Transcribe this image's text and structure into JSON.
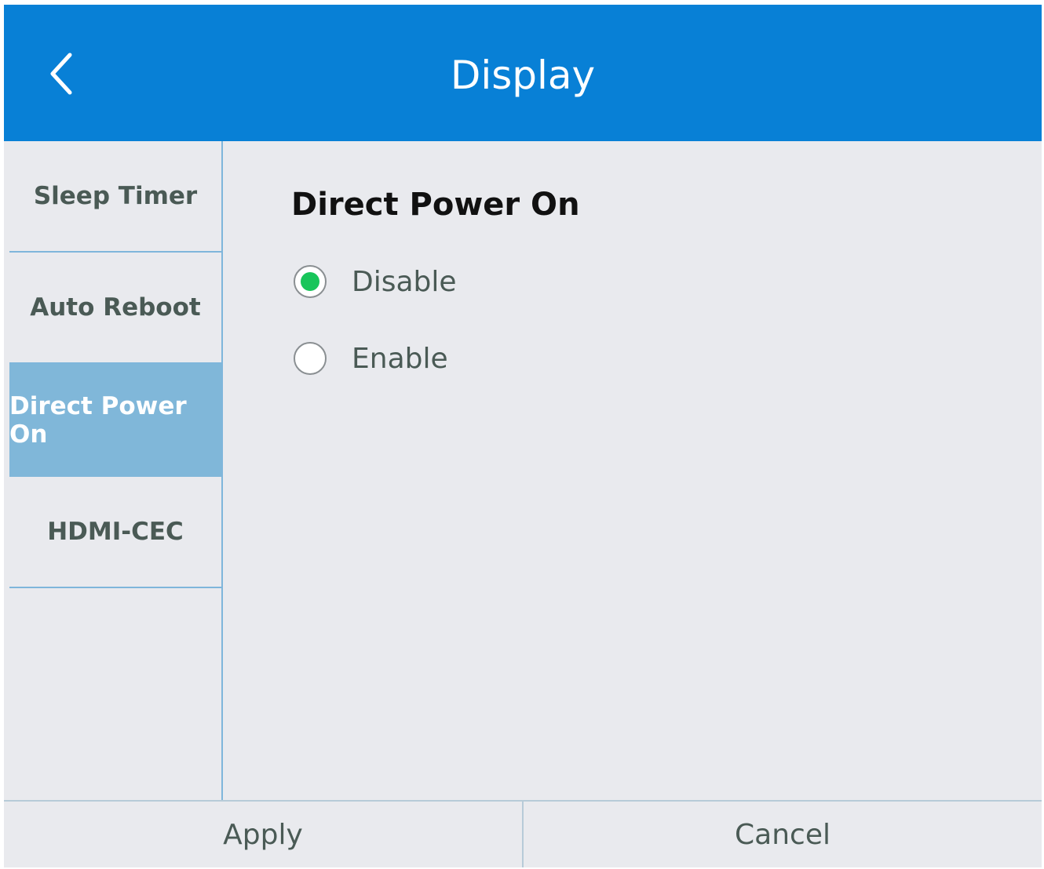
{
  "header": {
    "title": "Display",
    "back_icon": "chevron-left-icon"
  },
  "sidebar": {
    "items": [
      {
        "label": "Sleep Timer",
        "active": false
      },
      {
        "label": "Auto Reboot",
        "active": false
      },
      {
        "label": "Direct Power On",
        "active": true
      },
      {
        "label": "HDMI-CEC",
        "active": false
      }
    ]
  },
  "content": {
    "title": "Direct Power On",
    "options": [
      {
        "label": "Disable",
        "selected": true
      },
      {
        "label": "Enable",
        "selected": false
      }
    ]
  },
  "footer": {
    "apply_label": "Apply",
    "cancel_label": "Cancel"
  },
  "colors": {
    "header_bg": "#0880d6",
    "active_item_bg": "#80b7d9",
    "radio_selected": "#18c55a",
    "background": "#e9eaee"
  }
}
